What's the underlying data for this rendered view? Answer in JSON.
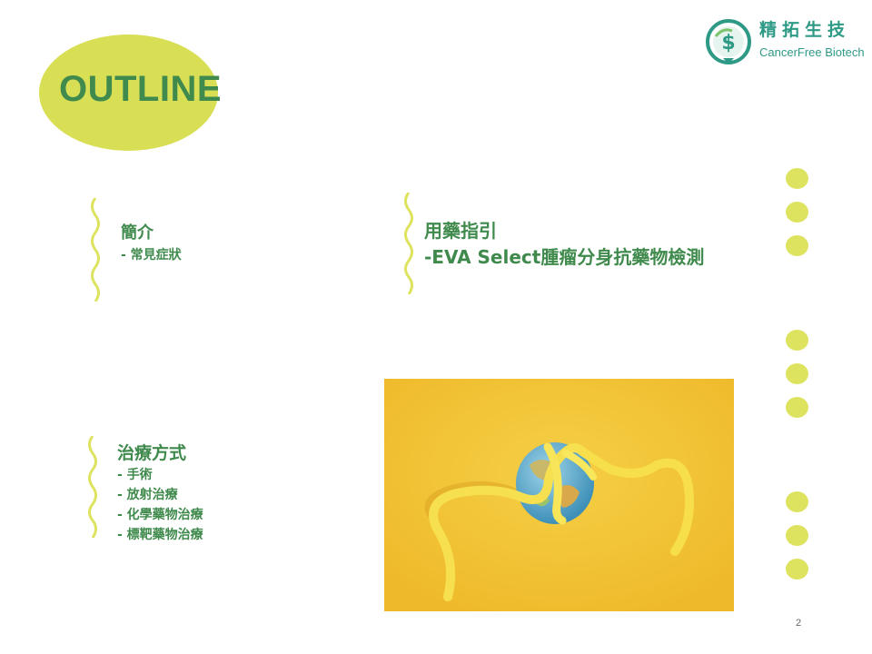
{
  "slide": {
    "title": "OUTLINE",
    "page_number": "2"
  },
  "logo": {
    "name_cn": "精拓生技",
    "name_en": "CancerFree Biotech",
    "icon": "dollar-leaf-icon"
  },
  "sections": [
    {
      "title": "簡介",
      "items": [
        "- 常見症狀"
      ]
    },
    {
      "title": "用藥指引",
      "items": [
        "-EVA Select腫瘤分身抗藥物檢測"
      ]
    },
    {
      "title": "治療方式",
      "items": [
        "- 手術",
        "- 放射治療",
        "- 化學藥物治療",
        "- 標靶藥物治療"
      ]
    }
  ],
  "photo": {
    "subject": "globe-with-yellow-ribbon-image"
  },
  "colors": {
    "accent_green": "#3f8a4c",
    "accent_yellow": "#dde35f",
    "logo_teal": "#2e9a86",
    "photo_background": "#f2c535"
  }
}
